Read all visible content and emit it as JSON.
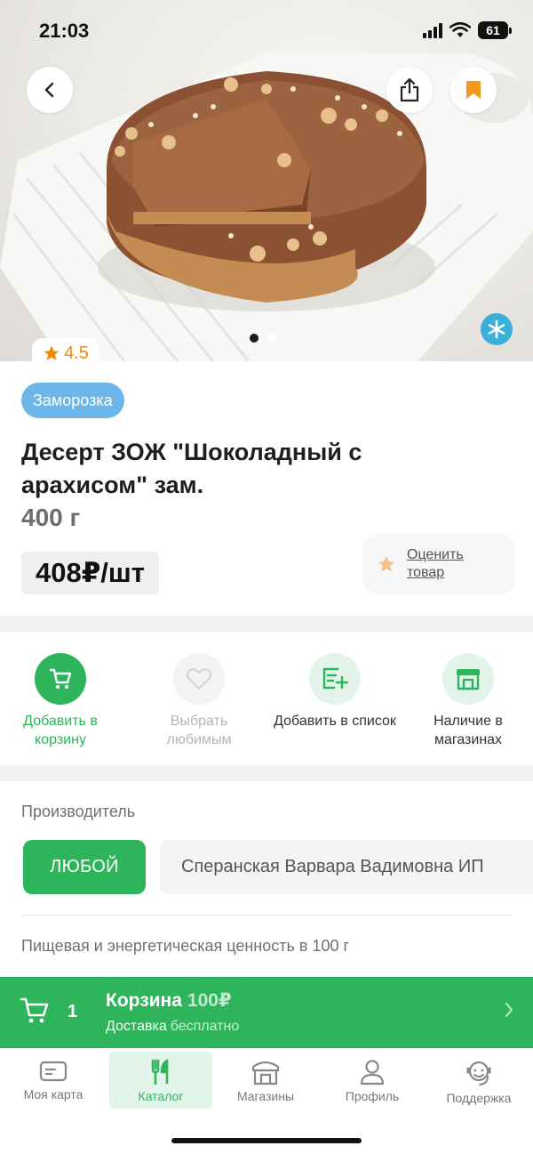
{
  "status_bar": {
    "time": "21:03",
    "battery": "61"
  },
  "hero": {
    "image": "cake-photo",
    "slides_total": 2,
    "active_slide": 1
  },
  "product": {
    "rating": "4.5",
    "category_chip": "Заморозка",
    "title": "Десерт ЗОЖ \"Шоколадный с арахисом\" зам.",
    "weight": "400 г",
    "price": "408₽/шт",
    "rate_label": "Оценить товар"
  },
  "actions": [
    {
      "label": "Добавить в корзину",
      "icon": "cart-icon"
    },
    {
      "label": "Выбрать любимым",
      "icon": "heart-icon"
    },
    {
      "label": "Добавить в список",
      "icon": "list-add-icon"
    },
    {
      "label": "Наличие в магазинах",
      "icon": "store-icon"
    }
  ],
  "manufacturer": {
    "heading": "Производитель",
    "any_label": "ЛЮБОЙ",
    "name": "Сперанская Варвара Вадимовна ИП"
  },
  "nutrition": {
    "heading": "Пищевая и энергетическая ценность в 100 г"
  },
  "cart": {
    "count": "1",
    "title": "Корзина",
    "sum": "100₽",
    "delivery_label": "Доставка",
    "delivery_value": "бесплатно"
  },
  "tabbar": [
    {
      "label": "Моя карта",
      "icon": "card-icon"
    },
    {
      "label": "Каталог",
      "icon": "catalog-icon",
      "active": true
    },
    {
      "label": "Магазины",
      "icon": "store-icon"
    },
    {
      "label": "Профиль",
      "icon": "profile-icon"
    },
    {
      "label": "Поддержка",
      "icon": "support-icon"
    }
  ],
  "colors": {
    "accent_green": "#2eb55c",
    "chip_blue": "#6cb6ea",
    "rating_orange": "#f08a00",
    "bookmark_orange": "#f39a1a"
  }
}
